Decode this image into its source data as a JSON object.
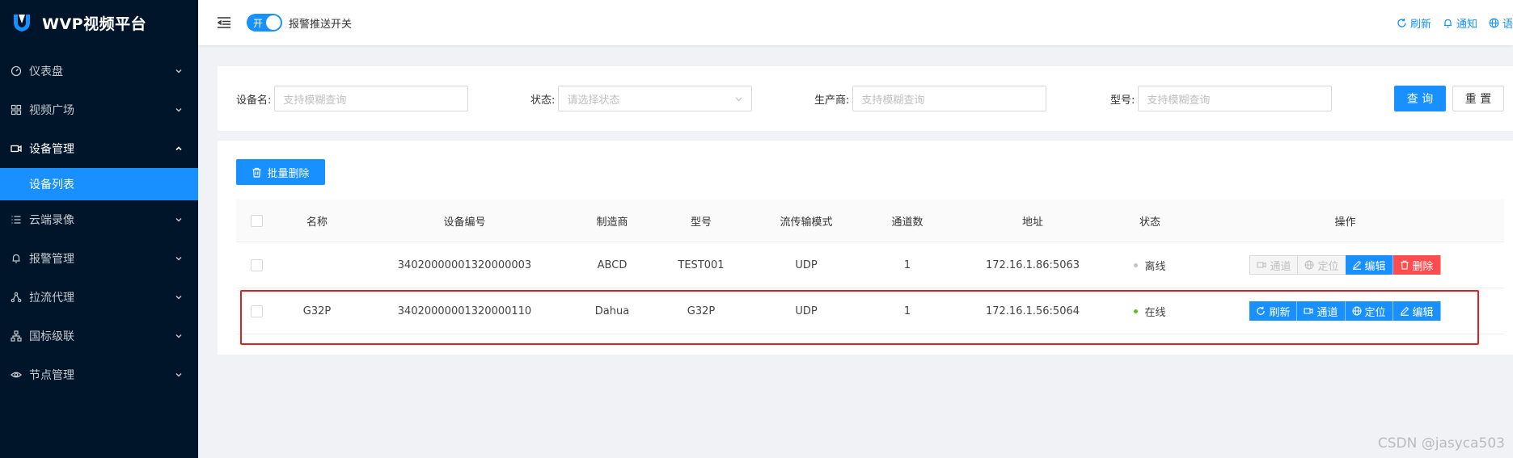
{
  "app": {
    "title": "WVP视频平台"
  },
  "sidebar": {
    "items": [
      {
        "label": "仪表盘",
        "icon": "dashboard-icon",
        "open": false
      },
      {
        "label": "视频广场",
        "icon": "grid-icon",
        "open": false
      },
      {
        "label": "设备管理",
        "icon": "camera-icon",
        "open": true
      },
      {
        "label": "云端录像",
        "icon": "list-icon",
        "open": false
      },
      {
        "label": "报警管理",
        "icon": "bell-icon",
        "open": false
      },
      {
        "label": "拉流代理",
        "icon": "share-icon",
        "open": false
      },
      {
        "label": "国标级联",
        "icon": "cluster-icon",
        "open": false
      },
      {
        "label": "节点管理",
        "icon": "eye-icon",
        "open": false
      }
    ],
    "submenu": {
      "label": "设备列表"
    }
  },
  "header": {
    "switch_text": "开",
    "switch_label": "报警推送开关",
    "refresh": "刷新",
    "notice": "通知",
    "language": "语"
  },
  "search": {
    "device_name_label": "设备名:",
    "device_name_placeholder": "支持模糊查询",
    "status_label": "状态:",
    "status_placeholder": "请选择状态",
    "manufacturer_label": "生产商:",
    "manufacturer_placeholder": "支持模糊查询",
    "model_label": "型号:",
    "model_placeholder": "支持模糊查询",
    "query_button": "查 询",
    "reset_button": "重 置"
  },
  "table": {
    "batch_delete": "批量删除",
    "columns": [
      "名称",
      "设备编号",
      "制造商",
      "型号",
      "流传输模式",
      "通道数",
      "地址",
      "状态",
      "操作"
    ],
    "rows": [
      {
        "name": "",
        "device_id": "34020000001320000003",
        "manufacturer": "ABCD",
        "model": "TEST001",
        "transport": "UDP",
        "channels": "1",
        "address": "172.16.1.86:5063",
        "status": "离线",
        "status_color": "#c0c4cc",
        "ops": [
          "通道",
          "定位",
          "编辑",
          "删除"
        ]
      },
      {
        "name": "G32P",
        "device_id": "34020000001320000110",
        "manufacturer": "Dahua",
        "model": "G32P",
        "transport": "UDP",
        "channels": "1",
        "address": "172.16.1.56:5064",
        "status": "在线",
        "status_color": "#52c41a",
        "ops": [
          "刷新",
          "通道",
          "定位",
          "编辑"
        ]
      }
    ]
  },
  "watermark": "CSDN @jasyca503",
  "colors": {
    "primary": "#1890ff",
    "danger": "#ff4d4f",
    "sidebar": "#001529",
    "highlight": "#e02020"
  }
}
